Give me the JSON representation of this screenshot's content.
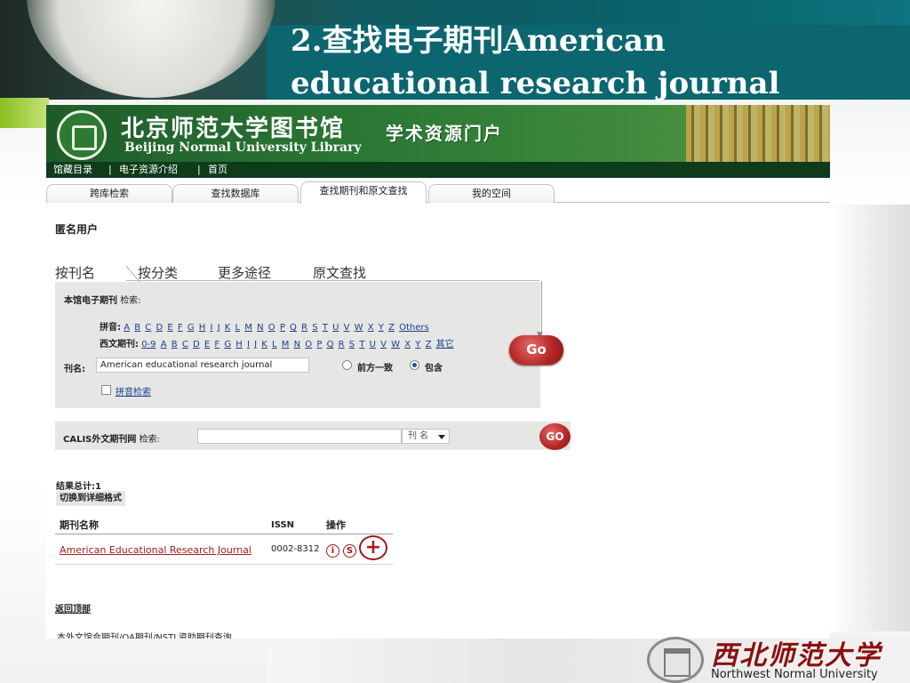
{
  "slide": {
    "title_line1": "2.查找电子期刊American",
    "title_line2": "educational research journal",
    "footer_cn": "西北师范大学",
    "footer_en": "Northwest Normal University",
    "colors": {
      "teal": "#0b6670",
      "accent_green": "#8bbf22",
      "maroon": "#8a1010"
    }
  },
  "library": {
    "name_cn": "北京师范大学图书馆",
    "name_en": "Beijing Normal University Library",
    "portal": "学术资源门户",
    "nav": {
      "catalog": "馆藏目录",
      "eresources": "电子资源介绍",
      "home": "首页",
      "separator": "|"
    },
    "tabs": [
      "跨库检索",
      "查找数据库",
      "查找期刊和原文查找",
      "我的空间"
    ],
    "active_tab": "查找期刊和原文查找",
    "user": "匿名用户",
    "search_tabs": [
      "按刊名",
      "按分类",
      "更多途径",
      "原文查找"
    ],
    "local_search": {
      "head_label": "本馆电子期刊",
      "head_suffix": "检索:",
      "pinyin_label": "拼音:",
      "pinyin_letters": [
        "A",
        "B",
        "C",
        "D",
        "E",
        "F",
        "G",
        "H",
        "I",
        "J",
        "K",
        "L",
        "M",
        "N",
        "O",
        "P",
        "Q",
        "R",
        "S",
        "T",
        "U",
        "V",
        "W",
        "X",
        "Y",
        "Z",
        "Others"
      ],
      "west_label": "西文期刊:",
      "west_letters": [
        "0-9",
        "A",
        "B",
        "C",
        "D",
        "E",
        "F",
        "G",
        "H",
        "I",
        "J",
        "K",
        "L",
        "M",
        "N",
        "O",
        "P",
        "Q",
        "R",
        "S",
        "T",
        "U",
        "V",
        "W",
        "X",
        "Y",
        "Z",
        "其它"
      ],
      "journal_label": "刊名:",
      "journal_value": "American educational research journal",
      "match_options": [
        "前方一致",
        "包含"
      ],
      "selected_match": "包含",
      "pinyin_check_label": "拼音检索",
      "go_label": "Go"
    },
    "calis": {
      "label": "CALIS外文期刊网",
      "label_suffix": "检索:",
      "select_value": "刊 名",
      "go_label": "GO"
    },
    "results": {
      "count_text": "结果总计:1",
      "switch_label": "切换到详细格式",
      "columns": [
        "期刊名称",
        "ISSN",
        "操作"
      ],
      "rows": [
        {
          "title": "American Educational Research Journal",
          "issn": "0002-8312",
          "icons": [
            "info-icon",
            "sfx-icon",
            "add-icon"
          ]
        }
      ]
    },
    "back_to_top": "返回顶部",
    "cut_text": "本外文馆合期刊/OA期刊/NSTL资助期刊查询"
  }
}
